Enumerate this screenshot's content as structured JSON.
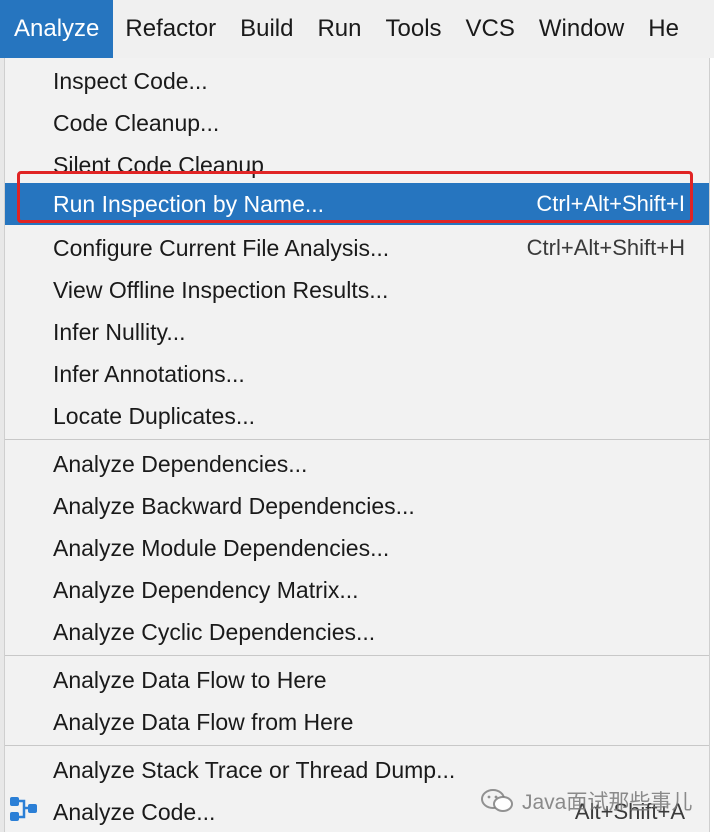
{
  "menubar": {
    "items": [
      {
        "label": "Analyze",
        "active": true
      },
      {
        "label": "Refactor"
      },
      {
        "label": "Build"
      },
      {
        "label": "Run"
      },
      {
        "label": "Tools"
      },
      {
        "label": "VCS"
      },
      {
        "label": "Window"
      },
      {
        "label": "He"
      }
    ]
  },
  "menu": {
    "items": [
      {
        "label": "Inspect Code..."
      },
      {
        "label": "Code Cleanup..."
      },
      {
        "label": "Silent Code Cleanup"
      },
      {
        "label": "Run Inspection by Name...",
        "shortcut": "Ctrl+Alt+Shift+I",
        "selected": true
      },
      {
        "label": "Configure Current File Analysis...",
        "shortcut": "Ctrl+Alt+Shift+H"
      },
      {
        "label": "View Offline Inspection Results..."
      },
      {
        "label": "Infer Nullity..."
      },
      {
        "label": "Infer Annotations..."
      },
      {
        "label": "Locate Duplicates..."
      },
      {
        "label": "Analyze Dependencies..."
      },
      {
        "label": "Analyze Backward Dependencies..."
      },
      {
        "label": "Analyze Module Dependencies..."
      },
      {
        "label": "Analyze Dependency Matrix..."
      },
      {
        "label": "Analyze Cyclic Dependencies..."
      },
      {
        "label": "Analyze Data Flow to Here"
      },
      {
        "label": "Analyze Data Flow from Here"
      },
      {
        "label": "Analyze Stack Trace or Thread Dump..."
      },
      {
        "label": "Analyze Code...",
        "shortcut": "Alt+Shift+A"
      }
    ]
  },
  "watermark": {
    "text": "Java面试那些事儿"
  },
  "colors": {
    "selection": "#2675bf",
    "highlight_box": "#e02424",
    "menu_bg": "#f2f2f2"
  }
}
